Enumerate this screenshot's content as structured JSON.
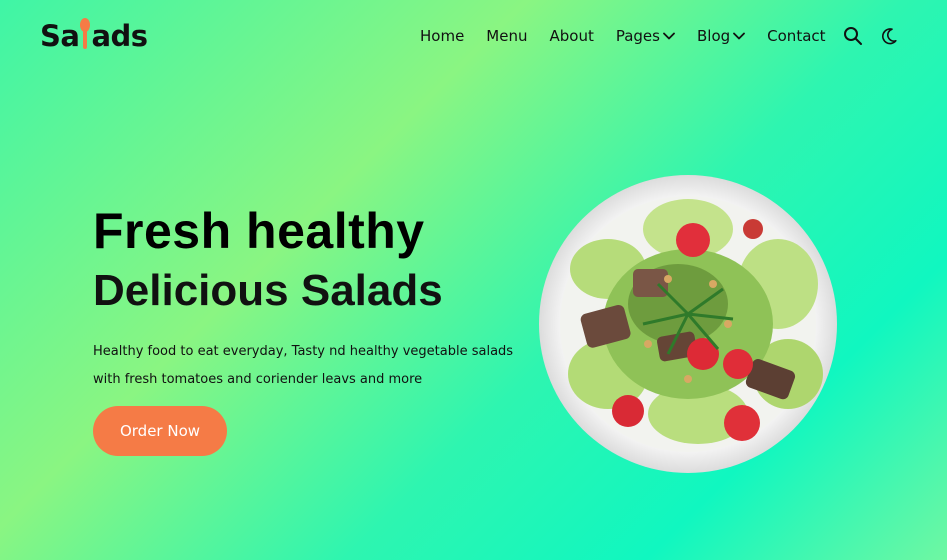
{
  "brand": {
    "logo_left": "Sa",
    "logo_right": "ads"
  },
  "nav": {
    "items": [
      {
        "label": "Home"
      },
      {
        "label": "Menu"
      },
      {
        "label": "About"
      },
      {
        "label": "Pages"
      },
      {
        "label": "Blog"
      },
      {
        "label": "Contact"
      }
    ],
    "icons": [
      "search-icon",
      "moon-icon"
    ]
  },
  "hero": {
    "title": "Fresh healthy",
    "subtitle": "Delicious Salads",
    "description_line1": "Healthy food to eat everyday, Tasty nd healthy vegetable salads",
    "description_line2": "with fresh tomatoes and coriender leavs and more",
    "cta_label": "Order Now"
  },
  "colors": {
    "accent": "#f57b46",
    "background_start": "#3ff5a6",
    "background_end": "#10f7c0",
    "text": "#111111"
  }
}
